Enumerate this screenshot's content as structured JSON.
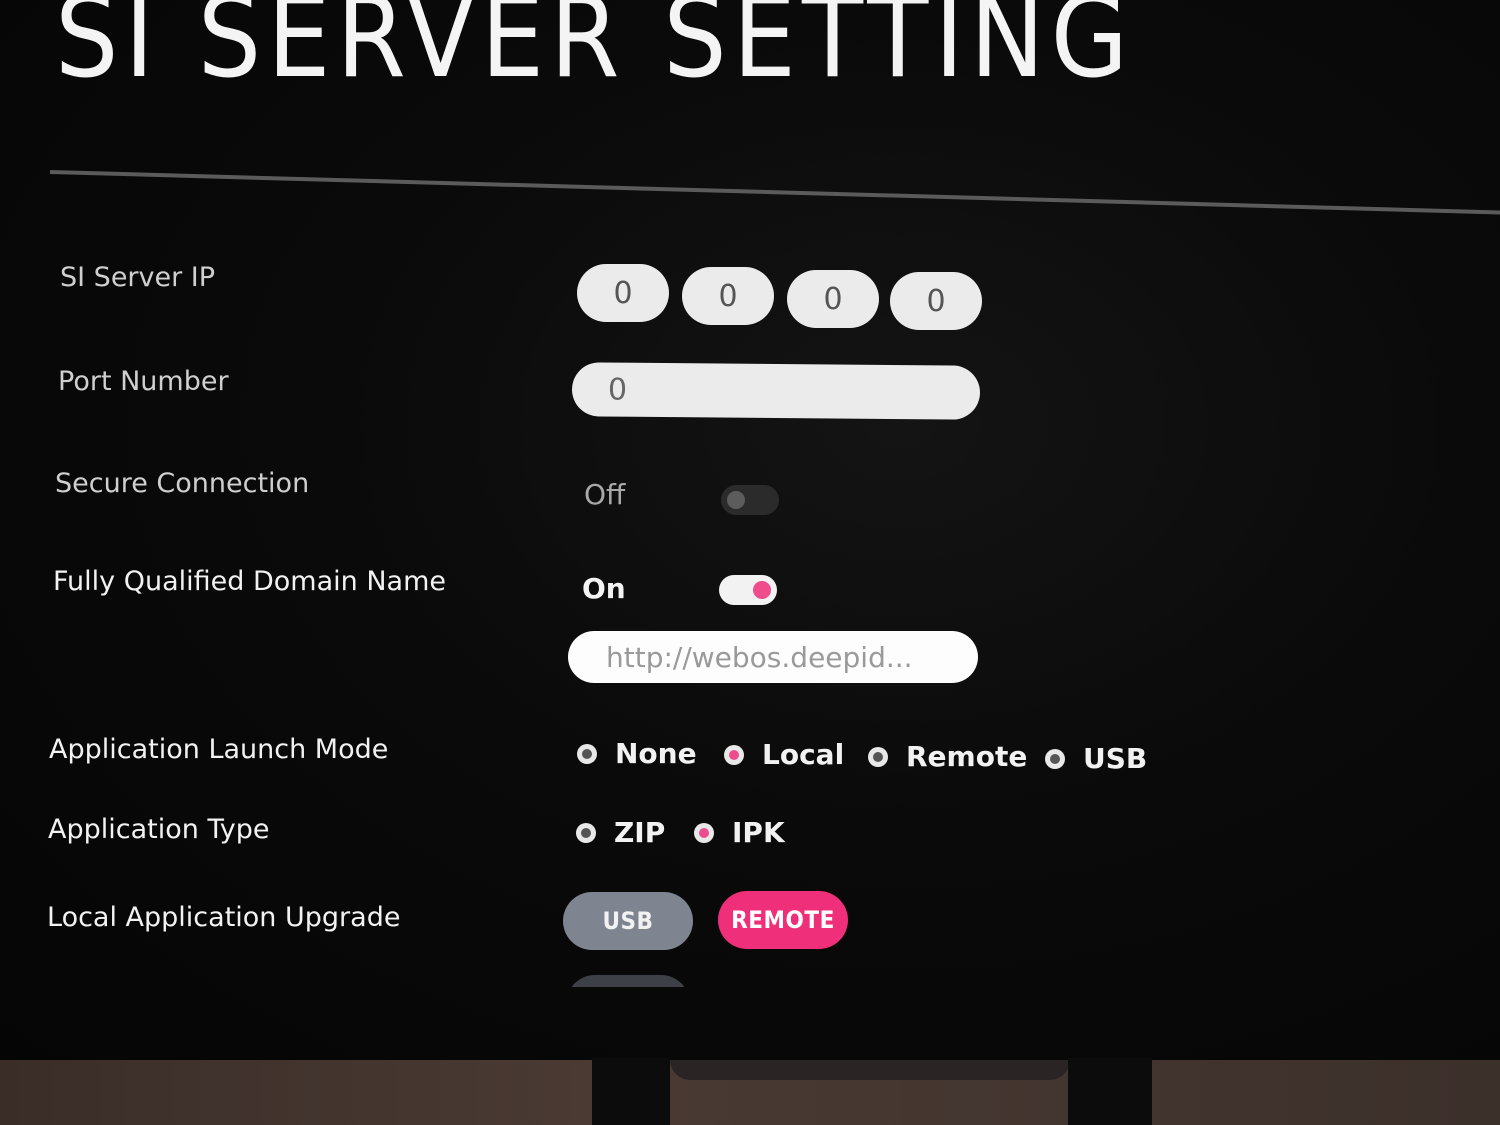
{
  "title": "SI SERVER SETTING",
  "si_server_ip": {
    "label": "SI Server IP",
    "octets": [
      "0",
      "0",
      "0",
      "0"
    ]
  },
  "port_number": {
    "label": "Port Number",
    "value": "0"
  },
  "secure_connection": {
    "label": "Secure Connection",
    "state": "Off"
  },
  "fqdn": {
    "label": "Fully Qualified Domain Name",
    "state": "On",
    "url": "http://webos.deepid..."
  },
  "launch_mode": {
    "label": "Application Launch Mode",
    "options": [
      "None",
      "Local",
      "Remote",
      "USB"
    ],
    "selected": "Local"
  },
  "app_type": {
    "label": "Application Type",
    "options": [
      "ZIP",
      "IPK"
    ],
    "selected": "IPK"
  },
  "local_upgrade": {
    "label": "Local Application Upgrade",
    "buttons": [
      "USB",
      "REMOTE"
    ]
  },
  "colors": {
    "accent": "#ef2f79",
    "toggle_knob_on": "#ee4c8a",
    "field_bg": "#ebebeb"
  }
}
